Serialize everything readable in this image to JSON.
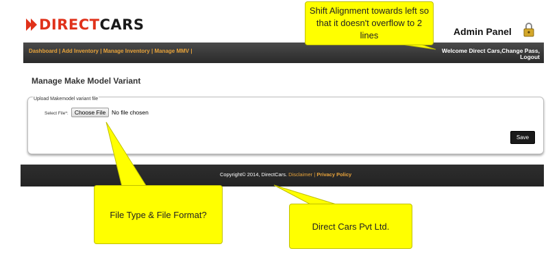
{
  "header": {
    "logo_red": "DIRECT",
    "logo_dark": "CARS",
    "admin_panel": "Admin Panel"
  },
  "nav": {
    "links": [
      "Dashboard",
      "Add Inventory",
      "Manage Inventory",
      "Manage MMV"
    ],
    "welcome": "Welcome Direct Cars,",
    "change_pass": "Change Pass,",
    "logout": "Logout"
  },
  "page": {
    "title": "Manage Make Model Variant"
  },
  "upload": {
    "legend": "Upload Makemodel variant file",
    "file_label": "Select File*:",
    "choose_label": "Choose File",
    "no_file": "No file chosen",
    "save_label": "Save"
  },
  "footer": {
    "copyright": "Copyright© 2014, DirectCars.",
    "disclaimer": "Disclaimer",
    "separator": "|",
    "privacy": "Privacy Policy"
  },
  "callouts": {
    "alignment": "Shift Alignment towards left so that it doesn't overflow to 2 lines",
    "file_type": "File Type & File Format?",
    "company": "Direct Cars Pvt Ltd."
  },
  "colors": {
    "brand_red": "#e0321b",
    "nav_link": "#e8a33a",
    "callout": "#ffff00"
  },
  "icons": {
    "logo": "double-arrow-icon",
    "admin": "lock-icon"
  }
}
